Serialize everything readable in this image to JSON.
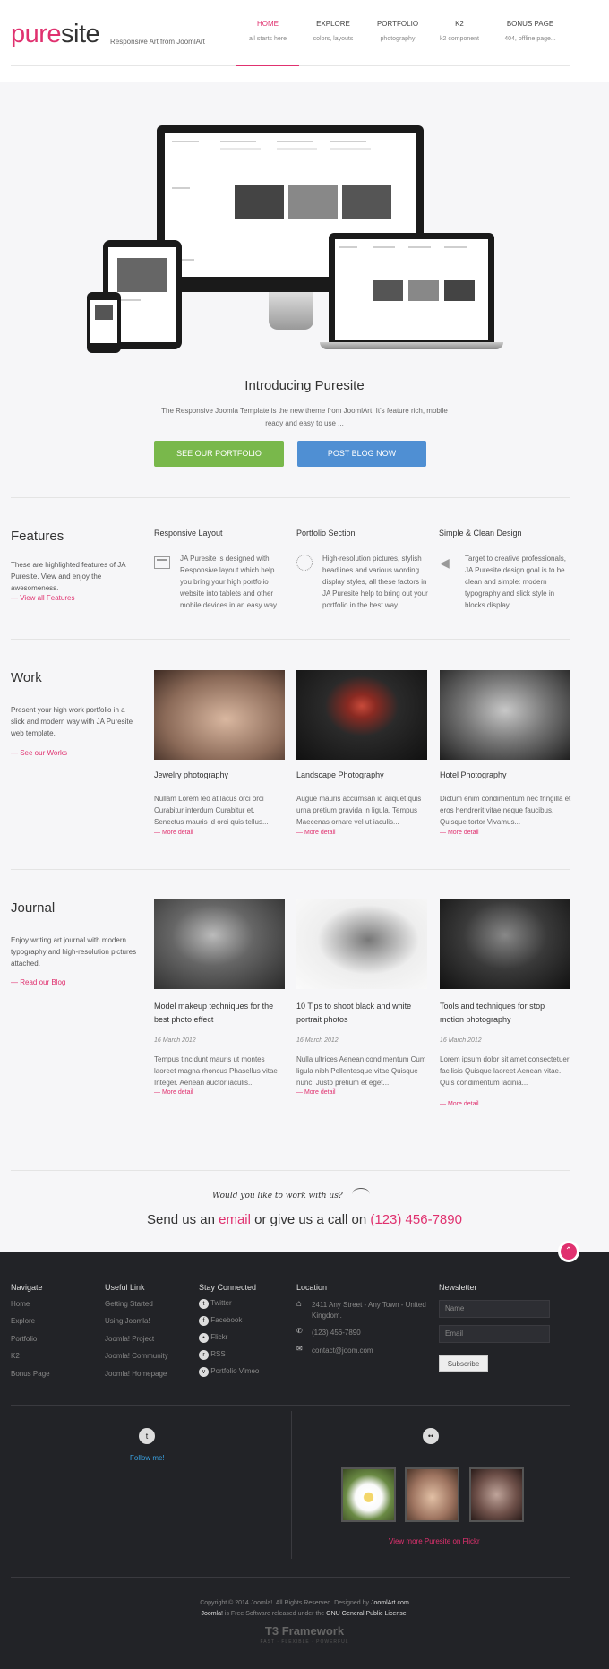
{
  "header": {
    "logo_pure": "pure",
    "logo_site": "site",
    "tagline": "Responsive Art from JoomlArt",
    "nav": [
      {
        "label": "HOME",
        "sub": "all starts here"
      },
      {
        "label": "EXPLORE",
        "sub": "colors, layouts"
      },
      {
        "label": "PORTFOLIO",
        "sub": "photography"
      },
      {
        "label": "K2",
        "sub": "k2 component"
      },
      {
        "label": "BONUS PAGE",
        "sub": "404, offline page..."
      }
    ]
  },
  "intro": {
    "title": "Introducing Puresite",
    "text": "The Responsive Joomla Template is the new theme from JoomlArt. It's feature rich, mobile ready and easy to use ...",
    "btn_portfolio": "SEE OUR PORTFOLIO",
    "btn_blog": "POST BLOG NOW"
  },
  "features": {
    "title": "Features",
    "text": "These are highlighted features of JA Puresite. View and enjoy the awesomeness.",
    "link": "— View all Features",
    "cols": [
      {
        "title": "Responsive Layout",
        "text": "JA Puresite is designed with Responsive layout which help you bring your high portfolio website into tablets and other mobile devices in an easy way."
      },
      {
        "title": "Portfolio Section",
        "text": "High-resolution pictures, stylish headlines and various wording display styles, all these factors in JA Puresite help to bring out your portfolio in the best way."
      },
      {
        "title": "Simple & Clean Design",
        "text": "Target to creative professionals, JA Puresite design goal is to be clean and simple: modern typography and slick style in blocks display."
      }
    ]
  },
  "work": {
    "title": "Work",
    "text": "Present your high work portfolio in a slick and modern way with JA Puresite web template.",
    "link": "— See our Works",
    "items": [
      {
        "title": "Jewelry photography",
        "text": "Nullam Lorem leo at lacus orci orci Curabitur interdum Curabitur et. Senectus mauris id orci quis tellus...",
        "more": "— More detail"
      },
      {
        "title": "Landscape Photography",
        "text": "Augue mauris accumsan id aliquet quis urna pretium gravida in ligula. Tempus Maecenas ornare vel ut iaculis...",
        "more": "— More detail"
      },
      {
        "title": "Hotel Photography",
        "text": "Dictum enim condimentum nec fringilla et eros hendrerit vitae neque faucibus. Quisque tortor Vivamus...",
        "more": "— More detail"
      }
    ]
  },
  "journal": {
    "title": "Journal",
    "text": "Enjoy writing art journal with modern typography and high-resolution pictures attached.",
    "link": "— Read our Blog",
    "items": [
      {
        "title": "Model makeup techniques for the best photo effect",
        "date": "16 March 2012",
        "text": "Tempus tincidunt mauris ut montes laoreet magna rhoncus Phasellus vitae Integer. Aenean auctor iaculis...",
        "more": "— More detail"
      },
      {
        "title": "10 Tips to shoot black and white portrait photos",
        "date": "16 March 2012",
        "text": "Nulla ultrices Aenean condimentum Cum ligula nibh Pellentesque vitae Quisque nunc. Justo pretium et eget...",
        "more": "— More detail"
      },
      {
        "title": "Tools and techniques for stop motion photography",
        "date": "16 March 2012",
        "text": "Lorem ipsum dolor sit amet consectetuer facilisis Quisque laoreet Aenean vitae. Quis condimentum lacinia...",
        "more": "— More detail"
      }
    ]
  },
  "cta": {
    "hand": "Would you like to work with us?",
    "pre": "Send us an ",
    "email": "email",
    "mid": " or give us a call on ",
    "phone": "(123) 456-7890"
  },
  "footer": {
    "navigate": {
      "title": "Navigate",
      "items": [
        "Home",
        "Explore",
        "Portfolio",
        "K2",
        "Bonus Page"
      ]
    },
    "useful": {
      "title": "Useful Link",
      "items": [
        "Getting Started",
        "Using Joomla!",
        "Joomla! Project",
        "Joomla! Community",
        "Joomla! Homepage"
      ]
    },
    "connected": {
      "title": "Stay Connected",
      "items": [
        "Twitter",
        "Facebook",
        "Flickr",
        "RSS",
        "Portfolio Vimeo"
      ]
    },
    "location": {
      "title": "Location",
      "address": "2411 Any Street - Any Town - United Kingdom.",
      "phone": "(123) 456-7890",
      "email": "contact@joom.com"
    },
    "newsletter": {
      "title": "Newsletter",
      "name_placeholder": "Name",
      "email_placeholder": "Email",
      "subscribe": "Subscribe"
    },
    "follow": "Follow me!",
    "flickr_link": "View more Puresite on Flickr",
    "copyright_pre": "Copyright © 2014 Joomla!. All Rights Reserved. Designed by ",
    "copyright_link": "JoomlArt.com",
    "license_pre": "Joomla!",
    "license_mid": " is Free Software released under the ",
    "license_link": "GNU General Public License.",
    "t3": "T3 Framework",
    "t3_sub": "FAST · FLEXIBLE · POWERFUL"
  },
  "colors": {
    "accent": "#e0316f",
    "green": "#79b84b",
    "blue": "#4f8fd3",
    "footer": "#222327"
  }
}
